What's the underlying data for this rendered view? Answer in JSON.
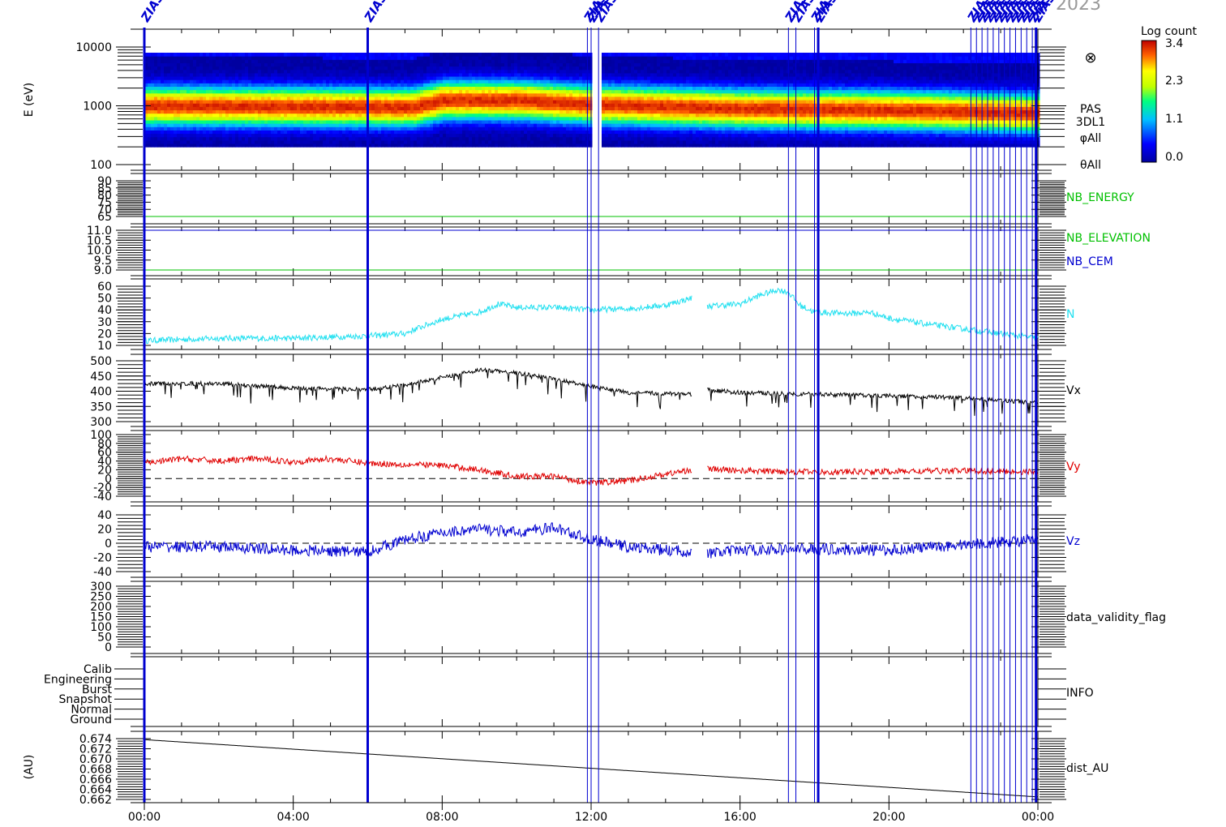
{
  "header": {
    "year_fragment": "2023"
  },
  "time_axis": {
    "labels": [
      "00:00",
      "04:00",
      "08:00",
      "12:00",
      "16:00",
      "20:00",
      "00:00"
    ],
    "range_hours": [
      0,
      24
    ]
  },
  "event_markers": {
    "label": "ZIAS",
    "times_hours": [
      0.0,
      6.0,
      11.9,
      12.0,
      12.2,
      17.3,
      17.5,
      18.0,
      18.1,
      22.2,
      22.35,
      22.5,
      22.65,
      22.8,
      22.95,
      23.1,
      23.25,
      23.4,
      23.55,
      23.7,
      23.85,
      23.95
    ],
    "color": "#0000d0"
  },
  "colorbar": {
    "title": "Log count",
    "ticks": [
      "3.4",
      "2.3",
      "1.1",
      "0.0"
    ],
    "min": 0.0,
    "max": 3.4
  },
  "colors": {
    "cyan": "#22e0f0",
    "red": "#e00000",
    "blue": "#0000d0",
    "green": "#00c000",
    "black": "#000000"
  },
  "chart_data": [
    {
      "type": "heatmap",
      "id": "pas_spectrogram",
      "ylabel": "E (eV)",
      "yscale": "log",
      "ylim": [
        100,
        10000
      ],
      "yticks": [
        "10000",
        "1000",
        "100"
      ],
      "right_labels": [
        "PAS",
        "3DL1",
        "φAll",
        "θAll"
      ],
      "peak_energy_ev": [
        {
          "t": 0,
          "e": 1000
        },
        {
          "t": 7.2,
          "e": 950
        },
        {
          "t": 8,
          "e": 1250
        },
        {
          "t": 10,
          "e": 1250
        },
        {
          "t": 12,
          "e": 1050
        },
        {
          "t": 16,
          "e": 900
        },
        {
          "t": 20,
          "e": 850
        },
        {
          "t": 24,
          "e": 750
        }
      ],
      "data_gap_hours": [
        11.95,
        12.25
      ],
      "data_range_ev": [
        200,
        8000
      ],
      "cross_symbol": "⊗"
    },
    {
      "type": "line",
      "id": "nb_energy",
      "ylim": [
        65,
        90
      ],
      "yticks": [
        "90",
        "85",
        "80",
        "75",
        "70",
        "65"
      ],
      "series": [
        {
          "name": "NB_ENERGY",
          "color": "green",
          "constant": 65
        }
      ]
    },
    {
      "type": "line",
      "id": "nb_elevation",
      "ylim": [
        9.0,
        11.0
      ],
      "yticks": [
        "11.0",
        "10.5",
        "10.0",
        "9.5",
        "9.0"
      ],
      "series": [
        {
          "name": "NB_ELEVATION",
          "color": "green",
          "constant": 9.0
        },
        {
          "name": "NB_CEM",
          "color": "blue",
          "constant": 11.0
        }
      ]
    },
    {
      "type": "line",
      "id": "density",
      "ylim": [
        10,
        60
      ],
      "yticks": [
        "60",
        "50",
        "40",
        "30",
        "20",
        "10"
      ],
      "series": [
        {
          "name": "N",
          "color": "cyan",
          "noise": 2.5,
          "gap": [
            14.7,
            15.1
          ],
          "points": [
            [
              0,
              14
            ],
            [
              1,
              15
            ],
            [
              2,
              16
            ],
            [
              3,
              16
            ],
            [
              4,
              16
            ],
            [
              5,
              17
            ],
            [
              6,
              18
            ],
            [
              7,
              20
            ],
            [
              7.3,
              24
            ],
            [
              8,
              32
            ],
            [
              8.5,
              35
            ],
            [
              9,
              38
            ],
            [
              9.5,
              45
            ],
            [
              10,
              42
            ],
            [
              11,
              42
            ],
            [
              12,
              40
            ],
            [
              13,
              41
            ],
            [
              14,
              44
            ],
            [
              14.7,
              50
            ],
            [
              15.1,
              43
            ],
            [
              16,
              45
            ],
            [
              16.5,
              52
            ],
            [
              17,
              57
            ],
            [
              17.3,
              55
            ],
            [
              17.6,
              44
            ],
            [
              18,
              38
            ],
            [
              19,
              37
            ],
            [
              19.5,
              38
            ],
            [
              20,
              33
            ],
            [
              21,
              28
            ],
            [
              22,
              24
            ],
            [
              23,
              20
            ],
            [
              24,
              16
            ]
          ]
        }
      ]
    },
    {
      "type": "line",
      "id": "vx",
      "ylim": [
        300,
        500
      ],
      "yticks": [
        "500",
        "450",
        "400",
        "350",
        "300"
      ],
      "series": [
        {
          "name": "Vx",
          "color": "black",
          "noise": 7,
          "spikes": true,
          "gap": [
            14.7,
            15.1
          ],
          "points": [
            [
              0,
              425
            ],
            [
              2,
              425
            ],
            [
              4,
              410
            ],
            [
              6,
              405
            ],
            [
              7,
              420
            ],
            [
              8,
              445
            ],
            [
              9,
              470
            ],
            [
              10,
              460
            ],
            [
              11,
              440
            ],
            [
              12,
              415
            ],
            [
              13,
              395
            ],
            [
              14.7,
              390
            ],
            [
              15.1,
              405
            ],
            [
              16,
              395
            ],
            [
              18,
              390
            ],
            [
              20,
              385
            ],
            [
              22,
              378
            ],
            [
              24,
              362
            ]
          ]
        }
      ]
    },
    {
      "type": "line",
      "id": "vy",
      "ylim": [
        -40,
        100
      ],
      "yticks": [
        "100",
        "80",
        "60",
        "40",
        "20",
        "0",
        "-20",
        "-40"
      ],
      "zero_line": true,
      "series": [
        {
          "name": "Vy",
          "color": "red",
          "noise": 7,
          "gap": [
            14.7,
            15.1
          ],
          "points": [
            [
              0,
              35
            ],
            [
              1,
              45
            ],
            [
              2,
              40
            ],
            [
              3,
              45
            ],
            [
              4,
              38
            ],
            [
              5,
              45
            ],
            [
              6,
              35
            ],
            [
              7,
              32
            ],
            [
              8,
              30
            ],
            [
              9,
              20
            ],
            [
              10,
              5
            ],
            [
              11,
              5
            ],
            [
              12,
              -10
            ],
            [
              13,
              -5
            ],
            [
              14,
              10
            ],
            [
              14.7,
              20
            ],
            [
              15.1,
              22
            ],
            [
              16,
              18
            ],
            [
              18,
              15
            ],
            [
              20,
              16
            ],
            [
              22,
              18
            ],
            [
              24,
              15
            ]
          ]
        }
      ]
    },
    {
      "type": "line",
      "id": "vz",
      "ylim": [
        -40,
        40
      ],
      "yticks": [
        "40",
        "20",
        "0",
        "-20",
        "-40"
      ],
      "zero_line": true,
      "series": [
        {
          "name": "Vz",
          "color": "blue",
          "noise": 8,
          "gap": [
            14.7,
            15.1
          ],
          "points": [
            [
              0,
              -5
            ],
            [
              2,
              -5
            ],
            [
              4,
              -10
            ],
            [
              6,
              -12
            ],
            [
              7,
              5
            ],
            [
              8,
              15
            ],
            [
              9,
              20
            ],
            [
              10,
              15
            ],
            [
              11,
              22
            ],
            [
              12,
              5
            ],
            [
              13,
              -5
            ],
            [
              14,
              -10
            ],
            [
              14.7,
              -12
            ],
            [
              15.1,
              -15
            ],
            [
              16,
              -10
            ],
            [
              18,
              -8
            ],
            [
              20,
              -10
            ],
            [
              22,
              -2
            ],
            [
              24,
              5
            ]
          ]
        }
      ]
    },
    {
      "type": "line",
      "id": "data_validity_flag",
      "ylim": [
        0,
        300
      ],
      "yticks": [
        "300",
        "250",
        "200",
        "150",
        "100",
        "50",
        "0"
      ],
      "series": []
    },
    {
      "type": "line",
      "id": "info",
      "categories": [
        "Calib",
        "Engineering",
        "Burst",
        "Snapshot",
        "Normal",
        "Ground"
      ],
      "right_label": "INFO",
      "series": []
    },
    {
      "type": "line",
      "id": "dist_au",
      "ylabel": "(AU)",
      "ylim": [
        0.662,
        0.674
      ],
      "yticks": [
        "0.674",
        "0.672",
        "0.670",
        "0.668",
        "0.666",
        "0.664",
        "0.662"
      ],
      "series": [
        {
          "name": "dist_AU",
          "color": "black",
          "points": [
            [
              0,
              0.6738
            ],
            [
              24,
              0.6625
            ]
          ]
        }
      ]
    }
  ]
}
